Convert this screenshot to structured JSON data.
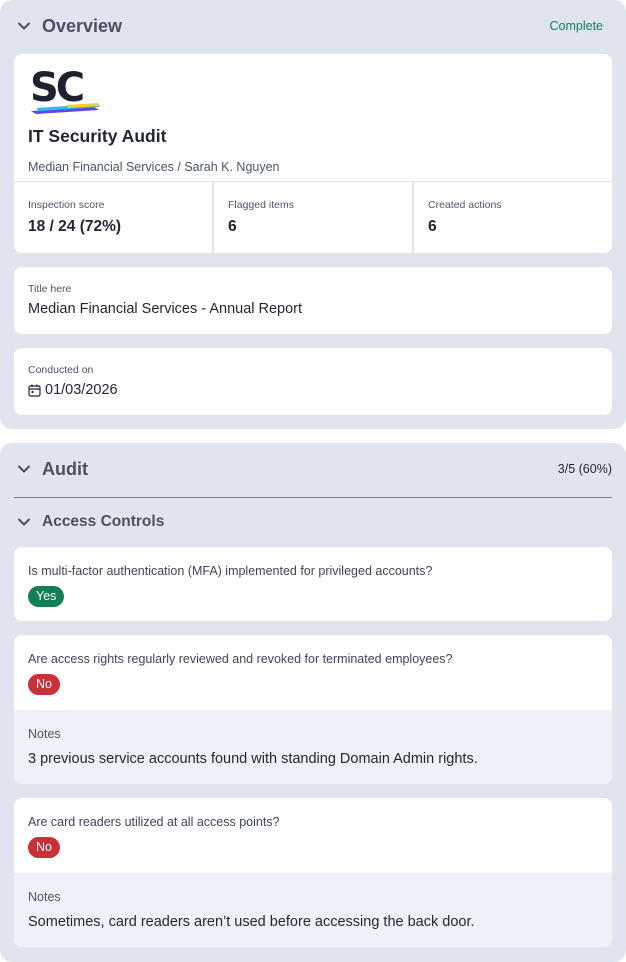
{
  "overview": {
    "title": "Overview",
    "status": "Complete",
    "status_color": "#1a7f5a",
    "logo_icon": "safetyculture-logo",
    "report_title": "IT Security Audit",
    "subtitle": "Median Financial Services / Sarah K. Nguyen",
    "stats": [
      {
        "label": "Inspection score",
        "value": "18 / 24 (72%)"
      },
      {
        "label": "Flagged items",
        "value": "6"
      },
      {
        "label": "Created actions",
        "value": "6"
      }
    ],
    "title_field": {
      "label": "Title here",
      "value": "Median Financial Services - Annual Report"
    },
    "conducted": {
      "label": "Conducted on",
      "icon": "calendar-icon",
      "value": "01/03/2026"
    }
  },
  "audit": {
    "title": "Audit",
    "progress": "3/5 (60%)",
    "subsection": "Access Controls",
    "questions": [
      {
        "text": "Is multi-factor authentication (MFA) implemented for privileged accounts?",
        "answer": "Yes",
        "answer_color": "#147f55"
      },
      {
        "text": "Are access rights regularly reviewed and revoked for terminated employees?",
        "answer": "No",
        "answer_color": "#c8303a",
        "notes_label": "Notes",
        "notes": "3 previous service accounts found with standing Domain Admin rights."
      },
      {
        "text": "Are card readers utilized at all access points?",
        "answer": "No",
        "answer_color": "#c8303a",
        "notes_label": "Notes",
        "notes": "Sometimes, card readers aren’t used before accessing the back door."
      }
    ]
  }
}
